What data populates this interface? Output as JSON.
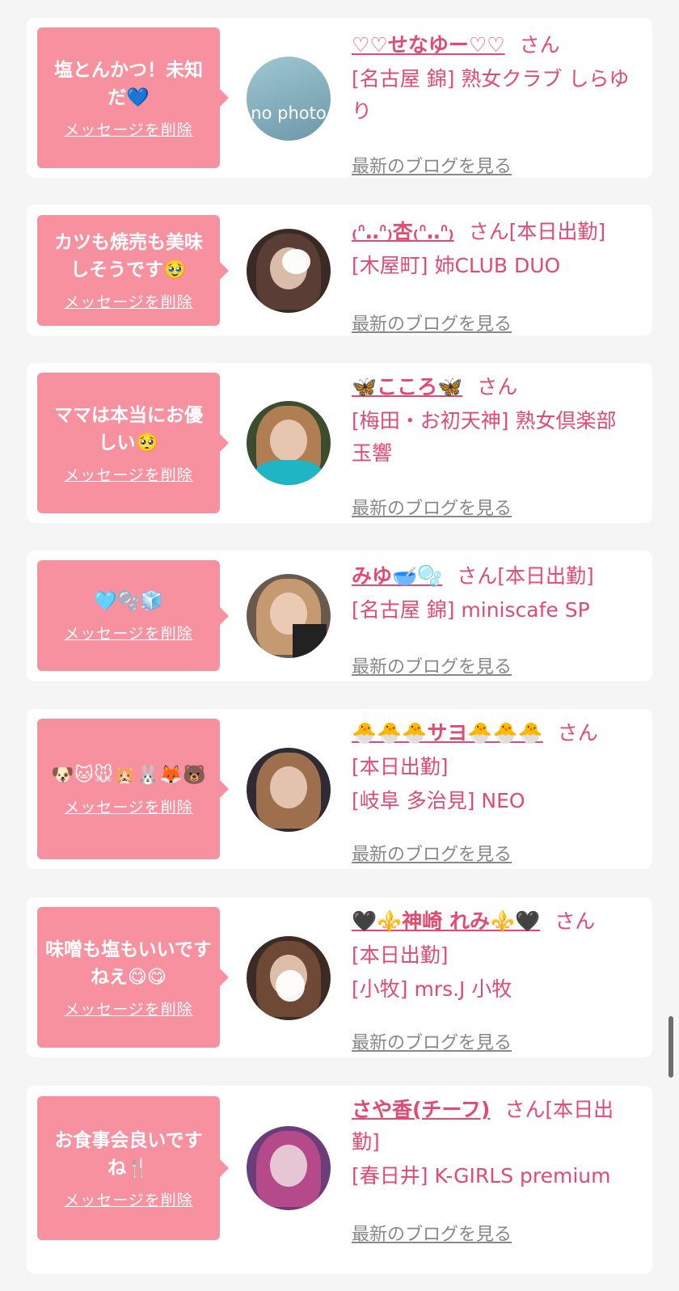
{
  "delete_label": "メッセージを削除",
  "blog_label": "最新のブログを見る",
  "san": "さん",
  "items": [
    {
      "message": "塩とんかつ！未知だ💙",
      "name": "♡♡せなゆー♡♡",
      "suffix": "さん",
      "shop": "[名古屋 錦] 熟女クラブ しらゆり",
      "avatar_label": "no photo"
    },
    {
      "message": "カツも焼売も美味しそうです🥹",
      "name": "₍ᐢ‥ᐢ₎杏₍ᐢ‥ᐢ₎",
      "suffix": "さん[本日出勤]",
      "shop": "[木屋町] 姉CLUB DUO",
      "avatar_label": ""
    },
    {
      "message": "ママは本当にお優しい🥺",
      "name": "🦋こころ🦋",
      "suffix": "さん",
      "shop": "[梅田・お初天神] 熟女倶楽部 玉響",
      "avatar_label": ""
    },
    {
      "message": "🩵🫧🧊",
      "name": "みゆ🥣🫧",
      "suffix": "さん[本日出勤]",
      "shop": "[名古屋 錦] miniscafe SP",
      "avatar_label": ""
    },
    {
      "message": "🐶🐱🐭🐹🐰🦊🐻",
      "name": "🐣🐣🐣サヨ🐣🐣🐣",
      "suffix": "さん",
      "shop_line1": "[本日出勤]",
      "shop": "[岐阜 多治見] NEO",
      "avatar_label": ""
    },
    {
      "message": "味噌も塩もいいですねえ😋😋",
      "name": "🖤⚜️神崎 れみ⚜️🖤",
      "suffix": "さん",
      "shop_line1": "[本日出勤]",
      "shop": "[小牧] mrs.J 小牧",
      "avatar_label": ""
    },
    {
      "message": "お食事会良いですね🍴",
      "name": "さや香(チーフ)",
      "suffix": "さん[本日出",
      "suffix_line2": "勤]",
      "shop": "[春日井] K-GIRLS premium",
      "avatar_label": ""
    }
  ],
  "colors": {
    "accent": "#e24a72",
    "bubble": "#f7909f",
    "background": "#f5f5f5"
  }
}
